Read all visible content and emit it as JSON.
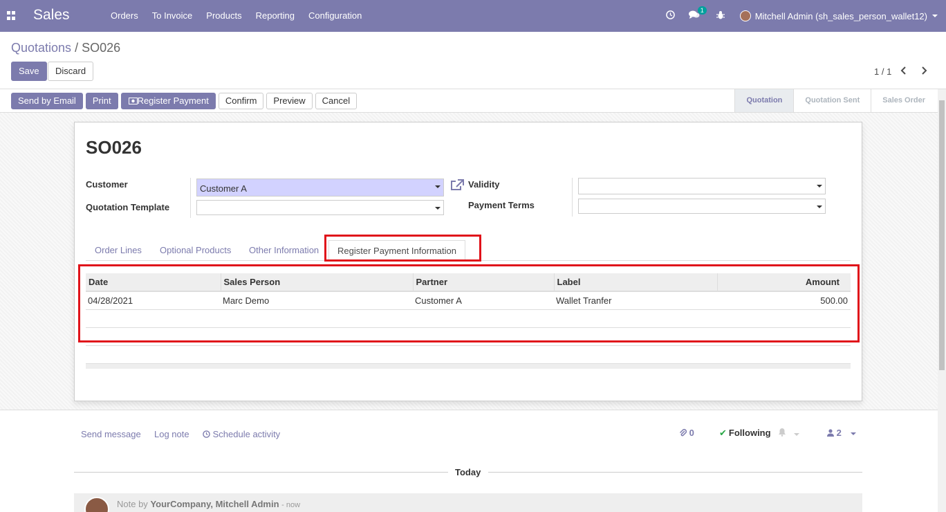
{
  "navbar": {
    "app_name": "Sales",
    "menu": [
      "Orders",
      "To Invoice",
      "Products",
      "Reporting",
      "Configuration"
    ],
    "message_badge": "1",
    "user": "Mitchell Admin (sh_sales_person_wallet12)",
    "color": "#7c7bad"
  },
  "breadcrumb": {
    "parent": "Quotations",
    "separator": " / ",
    "current": "SO026"
  },
  "buttons": {
    "save": "Save",
    "discard": "Discard"
  },
  "pager": {
    "text": "1 / 1"
  },
  "actions": [
    "Send by Email",
    "Print",
    "Register Payment",
    "Confirm",
    "Preview",
    "Cancel"
  ],
  "stages": [
    "Quotation",
    "Quotation Sent",
    "Sales Order"
  ],
  "form": {
    "name": "SO026",
    "customer_label": "Customer",
    "customer_value": "Customer A",
    "template_label": "Quotation Template",
    "template_value": "",
    "validity_label": "Validity",
    "validity_value": "",
    "terms_label": "Payment Terms",
    "terms_value": ""
  },
  "tabs": [
    "Order Lines",
    "Optional Products",
    "Other Information",
    "Register Payment Information"
  ],
  "table": {
    "headers": [
      "Date",
      "Sales Person",
      "Partner",
      "Label",
      "Amount"
    ],
    "rows": [
      [
        "04/28/2021",
        "Marc Demo",
        "Customer A",
        "Wallet Tranfer",
        "500.00"
      ]
    ]
  },
  "chatter": {
    "send_message": "Send message",
    "log_note": "Log note",
    "schedule_activity": "Schedule activity",
    "attachments": "0",
    "following": "Following",
    "followers": "2",
    "today": "Today",
    "note_prefix": "Note by",
    "note_author": "YourCompany, Mitchell Admin",
    "note_time": "now"
  },
  "highlight_color": "#e0121a"
}
